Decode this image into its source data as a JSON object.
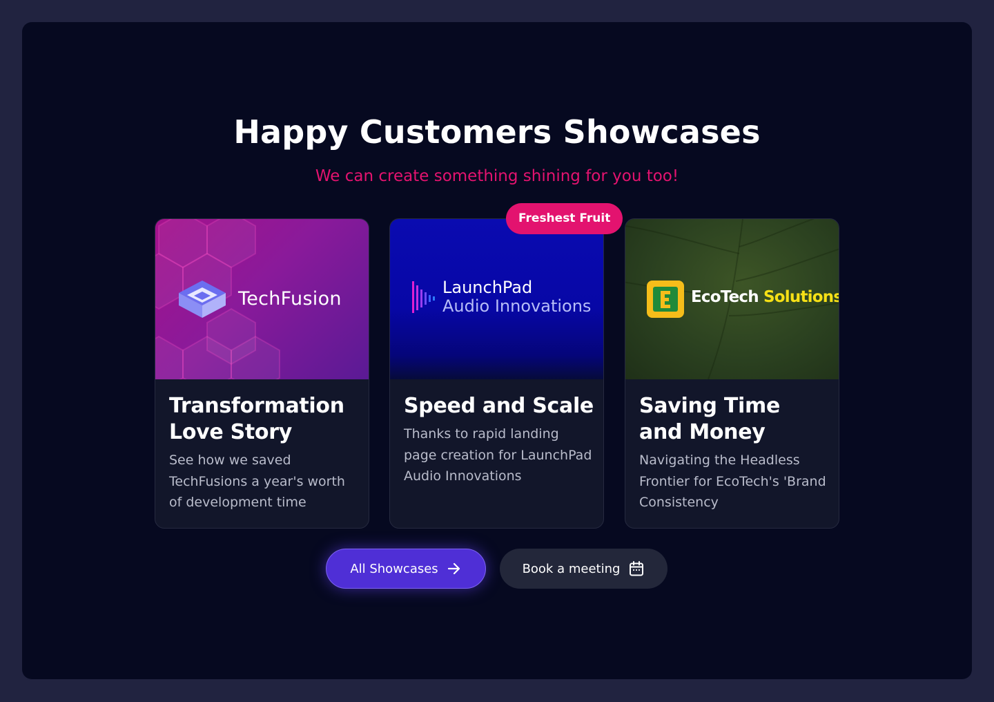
{
  "header": {
    "title": "Happy Customers Showcases",
    "subtitle": "We can create something shining for you too!"
  },
  "badge": {
    "label": "Freshest Fruit"
  },
  "cards": [
    {
      "logo_text": "TechFusion",
      "title": "Transformation Love Story",
      "description": "See how we saved TechFusions a year's worth of development time"
    },
    {
      "logo_line1": "LaunchPad",
      "logo_line2": "Audio Innovations",
      "title": "Speed and Scale",
      "description": "Thanks to rapid landing page creation for LaunchPad Audio Innovations"
    },
    {
      "logo_word1": "EcoTech",
      "logo_word2": "Solutions",
      "title": "Saving Time and Money",
      "description": "Navigating the Headless Frontier for EcoTech's 'Brand Consistency"
    }
  ],
  "actions": {
    "primary_label": "All Showcases",
    "primary_icon": "arrow-right-icon",
    "secondary_label": "Book a meeting",
    "secondary_icon": "calendar-icon"
  },
  "colors": {
    "accent_pink": "#e3136f",
    "primary_button": "#4f2fd6",
    "background": "#060920"
  }
}
